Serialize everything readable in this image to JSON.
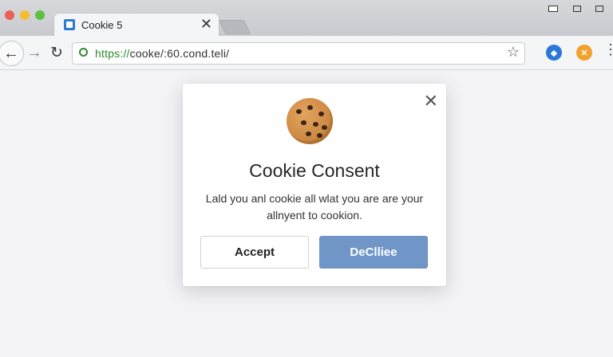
{
  "browser": {
    "tab": {
      "title": "Cookie 5",
      "favicon": "page-favicon-icon",
      "close_symbol": "✕"
    },
    "address_bar": {
      "scheme": "https://",
      "url_rest": "cooke/:60.cond.teli/"
    },
    "icons": {
      "back": "arrow-left-icon",
      "forward": "arrow-right-icon",
      "reload": "reload-icon",
      "secure": "secure-icon",
      "bookmark": "star-icon",
      "menu": "kebab-menu-icon"
    }
  },
  "modal": {
    "title": "Cookie Consent",
    "message_line1": "Lald you anl cookie all wlat you are are your",
    "message_line2": "allnyent to cookion.",
    "accept_label": "Accept",
    "decline_label": "DeClliee",
    "close_symbol": "✕",
    "illustration": "cookie-icon"
  },
  "colors": {
    "accent": "#7096c8",
    "secure_green": "#2c8a2c",
    "page_bg": "#f3f3f6"
  }
}
